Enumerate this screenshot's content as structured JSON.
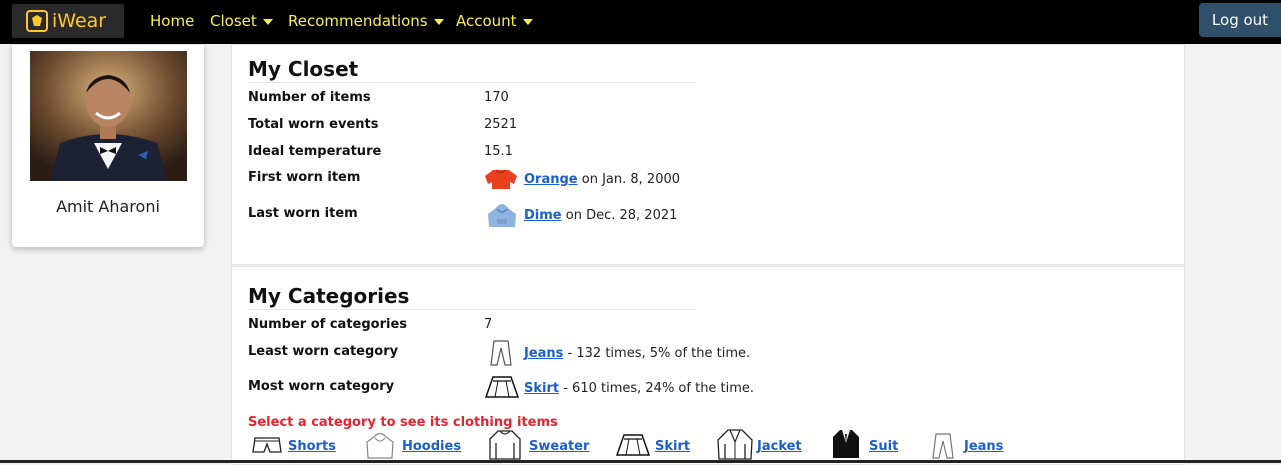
{
  "navbar": {
    "brand": "iWear",
    "links": [
      {
        "label": "Home",
        "dropdown": false
      },
      {
        "label": "Closet",
        "dropdown": true
      },
      {
        "label": "Recommendations",
        "dropdown": true
      },
      {
        "label": "Account",
        "dropdown": true
      }
    ],
    "logout_label": "Log out"
  },
  "profile": {
    "name": "Amit Aharoni"
  },
  "closet": {
    "title": "My Closet",
    "rows": [
      {
        "label": "Number of items",
        "value": "170"
      },
      {
        "label": "Total worn events",
        "value": "2521"
      },
      {
        "label": "Ideal temperature",
        "value": "15.1"
      }
    ],
    "first_worn": {
      "label": "First worn item",
      "item": "Orange",
      "suffix": " on Jan. 8, 2000",
      "icon": "sweater-icon",
      "color": "#e9401f"
    },
    "last_worn": {
      "label": "Last worn item",
      "item": "Dime",
      "suffix": " on Dec. 28, 2021",
      "icon": "hoodie-icon",
      "color": "#8fb3df"
    }
  },
  "categories": {
    "title": "My Categories",
    "count_label": "Number of categories",
    "count_value": "7",
    "least": {
      "label": "Least worn category",
      "item": "Jeans",
      "suffix": " - 132 times, 5% of the time.",
      "icon": "jeans-icon"
    },
    "most": {
      "label": "Most worn category",
      "item": "Skirt",
      "suffix": " - 610 times, 24% of the time.",
      "icon": "skirt-icon"
    },
    "prompt": "Select a category to see its clothing items",
    "items": [
      {
        "label": "Shorts",
        "icon": "shorts-icon"
      },
      {
        "label": "Hoodies",
        "icon": "hoodie-icon"
      },
      {
        "label": "Sweater",
        "icon": "sweater-icon"
      },
      {
        "label": "Skirt",
        "icon": "skirt-icon"
      },
      {
        "label": "Jacket",
        "icon": "jacket-icon"
      },
      {
        "label": "Suit",
        "icon": "suit-icon"
      },
      {
        "label": "Jeans",
        "icon": "jeans-icon"
      }
    ]
  },
  "colors": {
    "nav_link": "#f8f04a",
    "link": "#1a5fd0",
    "prompt": "#e8232f",
    "logout_bg": "#2f4f6a"
  }
}
